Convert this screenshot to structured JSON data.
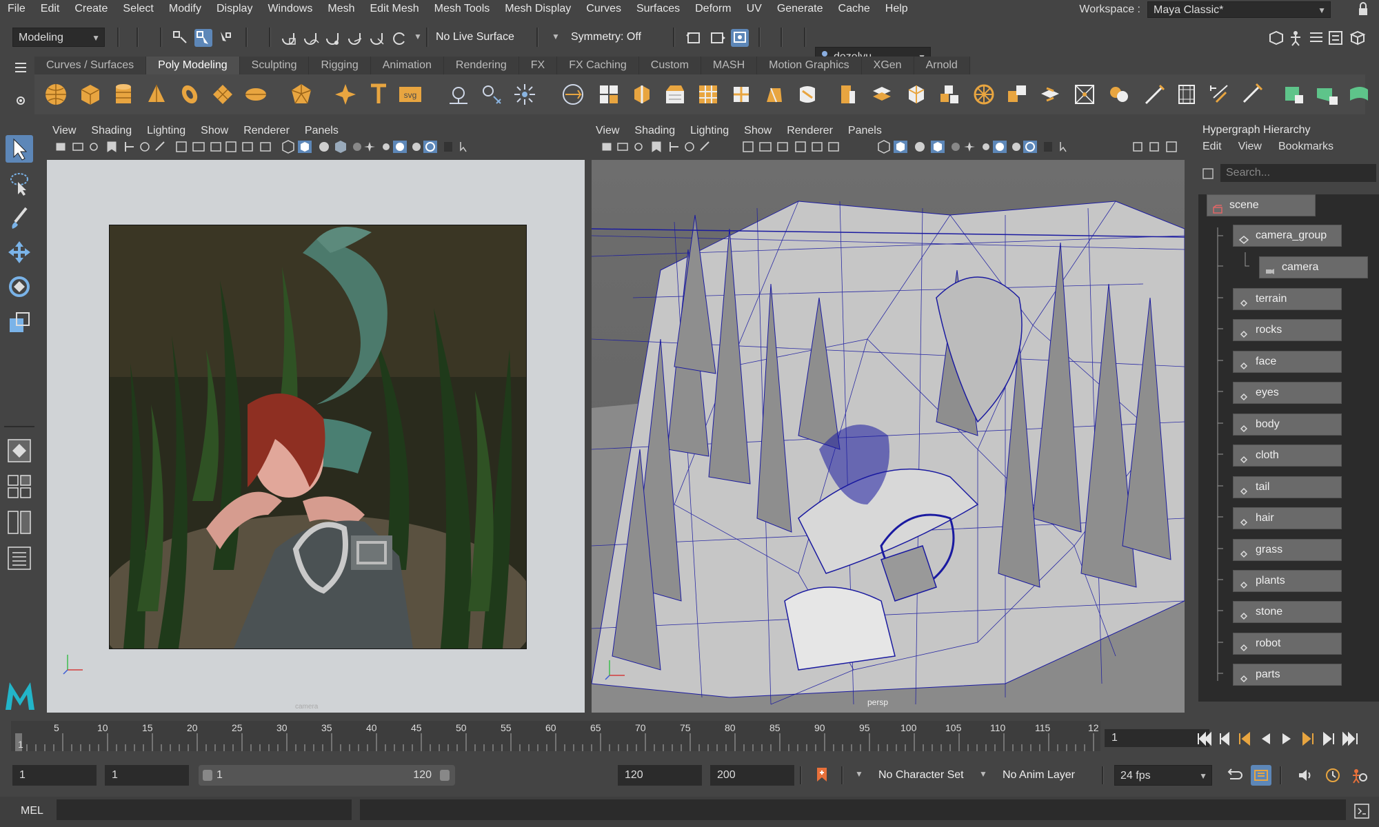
{
  "menubar": {
    "items": [
      "File",
      "Edit",
      "Create",
      "Select",
      "Modify",
      "Display",
      "Windows",
      "Mesh",
      "Edit Mesh",
      "Mesh Tools",
      "Mesh Display",
      "Curves",
      "Surfaces",
      "Deform",
      "UV",
      "Generate",
      "Cache",
      "Help"
    ],
    "workspace_label": "Workspace :",
    "workspace_value": "Maya Classic*"
  },
  "statusline": {
    "mode": "Modeling",
    "live_surface": "No Live Surface",
    "symmetry": "Symmetry: Off",
    "user": "dezelyu"
  },
  "shelf": {
    "tabs": [
      "Curves / Surfaces",
      "Poly Modeling",
      "Sculpting",
      "Rigging",
      "Animation",
      "Rendering",
      "FX",
      "FX Caching",
      "Custom",
      "MASH",
      "Motion Graphics",
      "XGen",
      "Arnold"
    ],
    "active_tab": "Poly Modeling"
  },
  "viewport_left": {
    "menus": [
      "View",
      "Shading",
      "Lighting",
      "Show",
      "Renderer",
      "Panels"
    ],
    "camera_label": "camera"
  },
  "viewport_right": {
    "menus": [
      "View",
      "Shading",
      "Lighting",
      "Show",
      "Renderer",
      "Panels"
    ],
    "camera_label": "persp"
  },
  "hypergraph": {
    "title": "Hypergraph Hierarchy",
    "menus": [
      "Edit",
      "View",
      "Bookmarks"
    ],
    "search_placeholder": "Search...",
    "nodes": {
      "scene": "scene",
      "camera_group": "camera_group",
      "camera": "camera",
      "terrain": "terrain",
      "rocks": "rocks",
      "face": "face",
      "eyes": "eyes",
      "body": "body",
      "cloth": "cloth",
      "tail": "tail",
      "hair": "hair",
      "grass": "grass",
      "plants": "plants",
      "stone": "stone",
      "robot": "robot",
      "parts": "parts"
    }
  },
  "timeline": {
    "ticks": [
      "1",
      "5",
      "10",
      "15",
      "20",
      "25",
      "30",
      "35",
      "40",
      "45",
      "50",
      "55",
      "60",
      "65",
      "70",
      "75",
      "80",
      "85",
      "90",
      "95",
      "100",
      "105",
      "110",
      "115",
      "12"
    ],
    "current_frame": "1"
  },
  "range": {
    "start": "1",
    "playback_start": "1",
    "slider_start": "1",
    "slider_end": "120",
    "playback_end": "120",
    "end": "200",
    "character_set": "No Character Set",
    "anim_layer": "No Anim Layer",
    "fps": "24 fps"
  },
  "commandline": {
    "label": "MEL"
  },
  "colors": {
    "accent": "#5d87b8",
    "wire": "#1a1aa0",
    "shelf_icon": "#e8a540"
  }
}
